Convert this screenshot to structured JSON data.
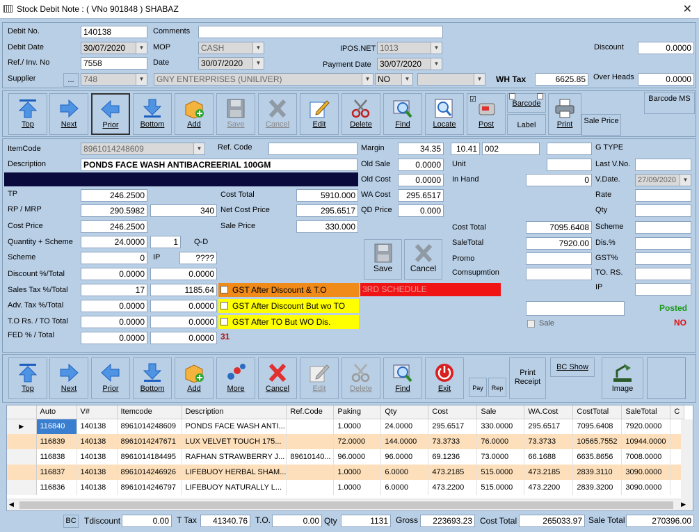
{
  "window": {
    "title": "Stock Debit Note : ( VNo 901848 )  SHABAZ"
  },
  "header": {
    "debit_no_label": "Debit No.",
    "debit_no": "140138",
    "comments_label": "Comments",
    "comments": "",
    "debit_date_label": "Debit Date",
    "debit_date": "30/07/2020",
    "mop_label": "MOP",
    "mop": "CASH",
    "ipos_label": "IPOS.NET",
    "ipos": "1013",
    "discount_label": "Discount",
    "discount": "0.0000",
    "ref_inv_label": "Ref./ Inv. No",
    "ref_inv": "7558",
    "date_label": "Date",
    "date": "30/07/2020",
    "payment_date_label": "Payment Date",
    "payment_date": "30/07/2020",
    "supplier_label": "Supplier",
    "supplier_btn": "...",
    "supplier_code": "748",
    "supplier_name": "GNY ENTERPRISES (UNILIVER)",
    "no_value": "NO",
    "wh_tax_label": "WH Tax",
    "wh_tax": "6625.85",
    "overheads_label": "Over Heads",
    "overheads": "0.0000"
  },
  "toolbar1": {
    "top": "Top",
    "next": "Next",
    "prior": "Prior",
    "bottom": "Bottom",
    "add": "Add",
    "save": "Save",
    "cancel": "Cancel",
    "edit": "Edit",
    "delete": "Delete",
    "find": "Find",
    "locate": "Locate",
    "post": "Post",
    "barcode": "Barcode",
    "label": "Label",
    "print": "Print",
    "barcode_ms": "Barcode MS",
    "sale_price": "Sale Price"
  },
  "item": {
    "itemcode_label": "ItemCode",
    "itemcode": "8961014248609",
    "refcode_label": "Ref. Code",
    "refcode": "",
    "margin_label": "Margin",
    "margin": "34.35",
    "margin2": "10.41",
    "margin3": "002",
    "gtype_label": "G TYPE",
    "description_label": "Description",
    "description": "PONDS FACE WASH ANTIBACREERIAL 100GM",
    "old_sale_label": "Old Sale",
    "old_sale": "0.0000",
    "unit_label": "Unit",
    "last_vno_label": "Last V.No.",
    "old_cost_label": "Old Cost",
    "old_cost": "0.0000",
    "in_hand_label": "In Hand",
    "in_hand": "0",
    "vdate_label": "V.Date.",
    "vdate": "27/09/2020",
    "tp_label": "TP",
    "tp": "246.2500",
    "cost_total_label": "Cost Total",
    "cost_total": "5910.000",
    "wa_cost_label": "WA Cost",
    "wa_cost": "295.6517",
    "rate_label": "Rate",
    "rp_label": "RP / MRP",
    "rp": "290.5982",
    "mrp": "340",
    "net_cost_label": "Net Cost Price",
    "net_cost": "295.6517",
    "qd_price_label": "QD Price",
    "qd_price": "0.000",
    "qty_label": "Qty",
    "cost_price_label": "Cost Price",
    "cost_price": "246.2500",
    "sale_price_label": "Sale Price",
    "sale_price": "330.000",
    "cost_total2_label": "Cost Total",
    "cost_total2": "7095.6408",
    "scheme_r_label": "Scheme",
    "qty_scheme_label": "Quantity + Scheme",
    "qty_val": "24.0000",
    "scheme_val": "1",
    "qd_label": "Q-D",
    "sale_total_label": "SaleTotal",
    "sale_total": "7920.00",
    "dis_label": "Dis.%",
    "scheme_label": "Scheme",
    "scheme": "0",
    "ip_label": "IP",
    "ip": "????",
    "promo_label": "Promo",
    "gst_label": "GST%",
    "discount_total_label": "Discount %/Total",
    "discount_pct": "0.0000",
    "discount_total": "0.0000",
    "consumption_label": "Comsupmtion",
    "to_rs_label": "TO. RS.",
    "sales_tax_label": "Sales Tax %/Total",
    "sales_tax_pct": "17",
    "sales_tax_total": "1185.64",
    "gst1": "GST After Discount & T.O",
    "schedule": "3RD SCHEDULE",
    "ip_r_label": "IP",
    "adv_tax_label": "Adv. Tax %/Total",
    "adv_tax_pct": "0.0000",
    "adv_tax_total": "0.0000",
    "gst2": "GST After Discount But wo TO",
    "posted": "Posted",
    "to_label": "T.O Rs. / TO Total",
    "to_rs": "0.0000",
    "to_total": "0.0000",
    "gst3": "GST After TO But WO Dis.",
    "sale_chk": "Sale",
    "no": "NO",
    "fed_label": "FED % / Total",
    "fed_pct": "0.0000",
    "fed_total": "0.0000",
    "count": "31",
    "save": "Save",
    "cancel": "Cancel"
  },
  "toolbar2": {
    "top": "Top",
    "next": "Next",
    "prior": "Prior",
    "bottom": "Bottom",
    "add": "Add",
    "more": "More",
    "cancel": "Cancel",
    "edit": "Edit",
    "delete": "Delete",
    "find": "Find",
    "exit": "Exit",
    "pay": "Pay",
    "rep": "Rep",
    "print_receipt": "Print Receipt",
    "bc_show": "BC Show",
    "image": "Image"
  },
  "grid": {
    "columns": [
      "Auto",
      "V#",
      "Itemcode",
      "Description",
      "Ref.Code",
      "Paking",
      "Qty",
      "Cost",
      "Sale",
      "WA.Cost",
      "CostTotal",
      "SaleTotal",
      "C"
    ],
    "rows": [
      [
        "116840",
        "140138",
        "8961014248609",
        "PONDS FACE WASH ANTI...",
        "",
        "1.0000",
        "24.0000",
        "295.6517",
        "330.0000",
        "295.6517",
        "7095.6408",
        "7920.0000",
        ""
      ],
      [
        "116839",
        "140138",
        "8961014247671",
        "LUX VELVET TOUCH 175...",
        "",
        "72.0000",
        "144.0000",
        "73.3733",
        "76.0000",
        "73.3733",
        "10565.7552",
        "10944.0000",
        ""
      ],
      [
        "116838",
        "140138",
        "8961014184495",
        "RAFHAN STRAWBERRY J...",
        "89610140...",
        "96.0000",
        "96.0000",
        "69.1236",
        "73.0000",
        "66.1688",
        "6635.8656",
        "7008.0000",
        ""
      ],
      [
        "116837",
        "140138",
        "8961014246926",
        "LIFEBUOY HERBAL SHAM...",
        "",
        "1.0000",
        "6.0000",
        "473.2185",
        "515.0000",
        "473.2185",
        "2839.3110",
        "3090.0000",
        ""
      ],
      [
        "116836",
        "140138",
        "8961014246797",
        "LIFEBUOY NATURALLY L...",
        "",
        "1.0000",
        "6.0000",
        "473.2200",
        "515.0000",
        "473.2200",
        "2839.3200",
        "3090.0000",
        ""
      ]
    ]
  },
  "footer": {
    "bc": "BC",
    "tdiscount_label": "Tdiscount",
    "tdiscount": "0.00",
    "ttax_label": "T Tax",
    "ttax": "41340.76",
    "to_label": "T.O.",
    "to": "0.00",
    "qty_label": "Qty",
    "qty": "1131",
    "gross_label": "Gross",
    "gross": "223693.23",
    "cost_total_label": "Cost Total",
    "cost_total": "265033.97",
    "sale_total_label": "Sale Total",
    "sale_total": "270396.00"
  }
}
